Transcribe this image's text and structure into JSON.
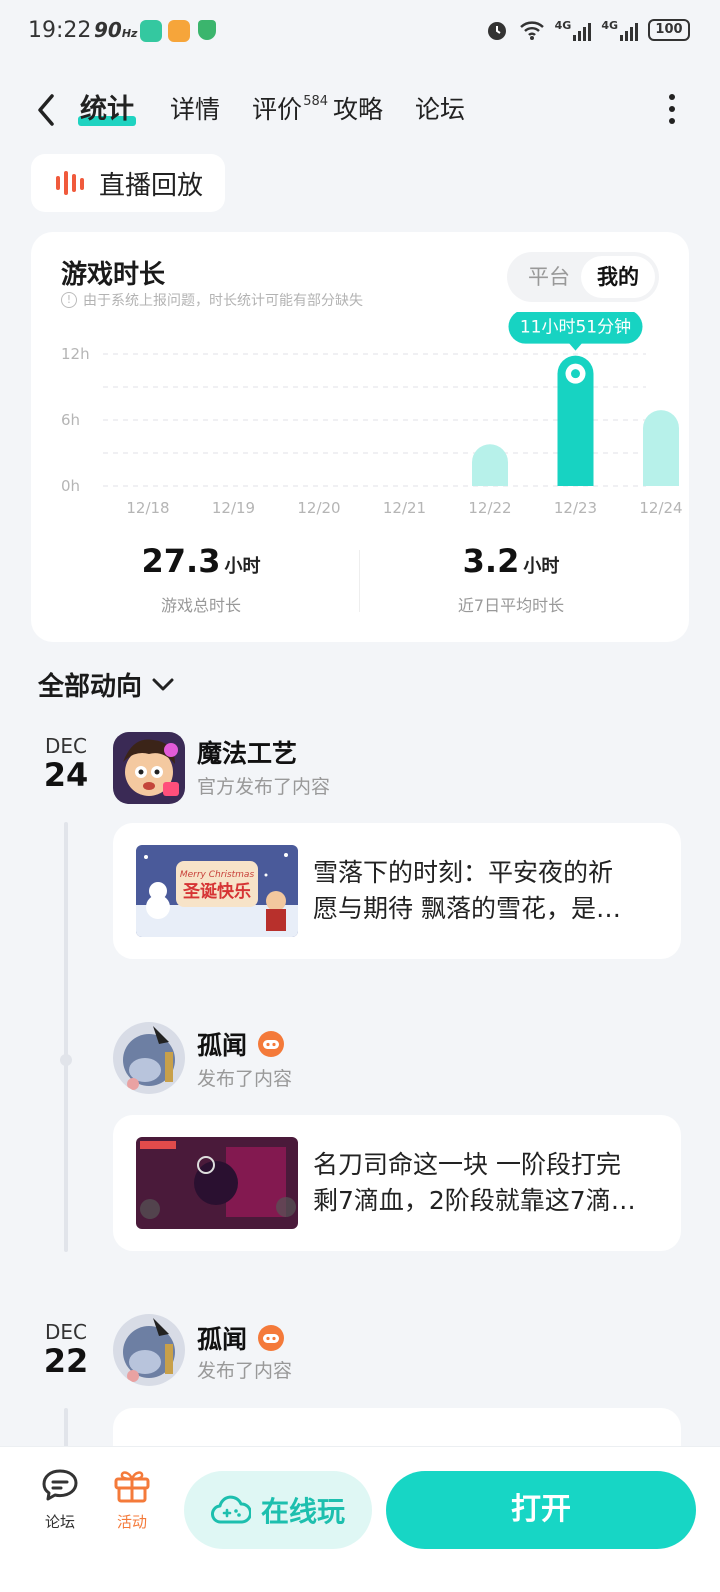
{
  "status_bar": {
    "time": "19:22",
    "refresh": "90",
    "refresh_unit": "Hz",
    "network_1": "4G",
    "network_2": "4G",
    "battery": "100"
  },
  "nav": {
    "tabs": [
      {
        "label": "统计"
      },
      {
        "label": "详情"
      },
      {
        "label": "评价",
        "badge": "584"
      },
      {
        "label": "攻略"
      },
      {
        "label": "论坛"
      }
    ]
  },
  "live_replay": {
    "label": "直播回放"
  },
  "stats": {
    "title": "游戏时长",
    "note": "由于系统上报问题，时长统计可能有部分缺失",
    "toggle": {
      "off": "平台",
      "on": "我的"
    },
    "total_value": "27.3",
    "total_unit": "小时",
    "total_label": "游戏总时长",
    "avg_value": "3.2",
    "avg_unit": "小时",
    "avg_label": "近7日平均时长"
  },
  "chart_data": {
    "type": "bar",
    "categories": [
      "12/18",
      "12/19",
      "12/20",
      "12/21",
      "12/22",
      "12/23",
      "12/24"
    ],
    "values": [
      0,
      0,
      0,
      0,
      3.8,
      11.85,
      6.9
    ],
    "y_ticks": [
      "0h",
      "6h",
      "12h"
    ],
    "ylim": [
      0,
      12
    ],
    "highlight_index": 5,
    "tooltip": "11小时51分钟",
    "colors": {
      "highlight": "#17d3c2",
      "normal": "#b7f1ea",
      "tooltip_bg": "#17d3c2"
    }
  },
  "feed": {
    "filter_label": "全部动向",
    "entries": [
      {
        "date_mon": "DEC",
        "date_day": "24",
        "author": "魔法工艺",
        "action": "官方发布了内容",
        "post_line1": "雪落下的时刻：平安夜的祈",
        "post_line2": "愿与期待 飘落的雪花，是…",
        "thumb_text": "Merry Christmas",
        "thumb_title": "圣诞快乐"
      },
      {
        "author": "孤闻",
        "action": "发布了内容",
        "post_line1": "名刀司命这一块 一阶段打完",
        "post_line2": "剩7滴血，2阶段就靠这7滴…"
      },
      {
        "date_mon": "DEC",
        "date_day": "22",
        "author": "孤闻",
        "action": "发布了内容"
      }
    ]
  },
  "bottom_bar": {
    "forum_label": "论坛",
    "activity_label": "活动",
    "play_online_label": "在线玩",
    "open_label": "打开",
    "colors": {
      "accent": "#17d6c5",
      "activity": "#f47a3a"
    }
  }
}
